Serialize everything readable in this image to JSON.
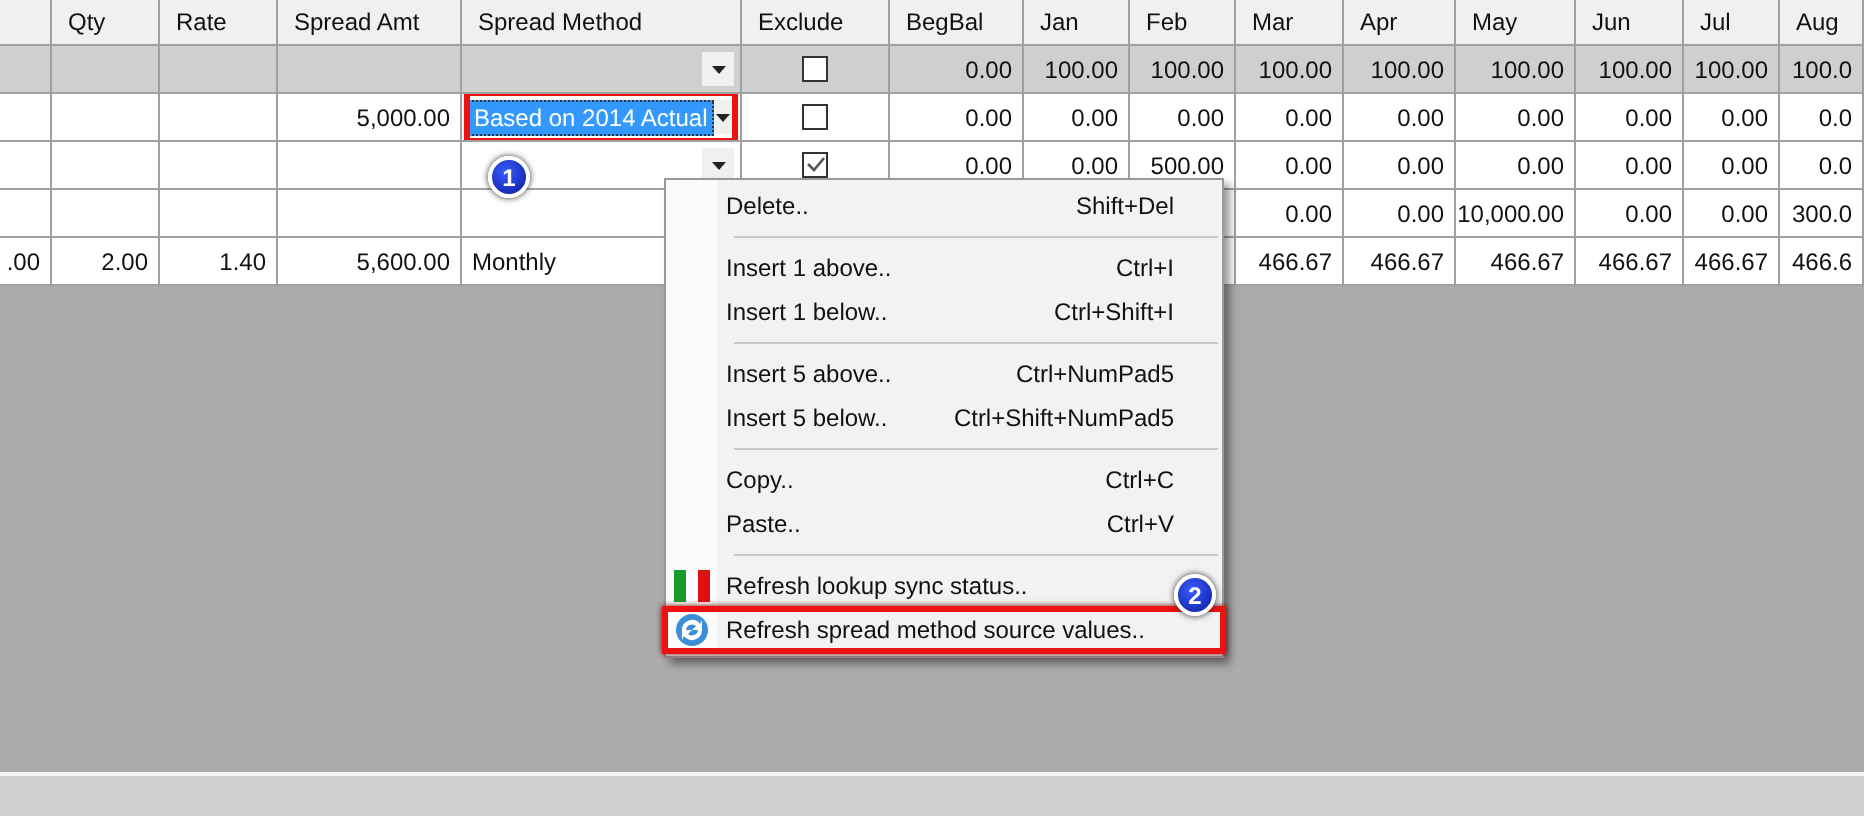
{
  "columns": [
    null,
    "Qty",
    "Rate",
    "Spread Amt",
    "Spread Method",
    "Exclude",
    "BegBal",
    "Jan",
    "Feb",
    "Mar",
    "Apr",
    "May",
    "Jun",
    "Jul",
    "Aug"
  ],
  "rows": [
    {
      "kind": "filter",
      "cells": [
        null,
        null,
        null,
        null,
        {
          "kind": "dropdown",
          "highlighted": false
        },
        {
          "kind": "checkbox",
          "checked": false
        },
        "0.00",
        "100.00",
        "100.00",
        "100.00",
        "100.00",
        "100.00",
        "100.00",
        "100.00",
        "100.0"
      ]
    },
    {
      "kind": "data",
      "cells": [
        null,
        null,
        null,
        "5,000.00",
        {
          "kind": "dropdown",
          "value": "Based on 2014 Actual",
          "highlighted": true
        },
        {
          "kind": "checkbox",
          "checked": false
        },
        "0.00",
        "0.00",
        "0.00",
        "0.00",
        "0.00",
        "0.00",
        "0.00",
        "0.00",
        "0.0"
      ]
    },
    {
      "kind": "data",
      "cells": [
        null,
        null,
        null,
        null,
        {
          "kind": "dropdown",
          "highlighted": false
        },
        {
          "kind": "checkbox",
          "checked": true
        },
        "0.00",
        "0.00",
        "500.00",
        "0.00",
        "0.00",
        "0.00",
        "0.00",
        "0.00",
        "0.0"
      ]
    },
    {
      "kind": "data",
      "cells": [
        null,
        null,
        null,
        null,
        null,
        null,
        null,
        null,
        null,
        "0.00",
        "0.00",
        "10,000.00",
        "0.00",
        "0.00",
        "300.0"
      ]
    },
    {
      "kind": "data",
      "cells": [
        ".00",
        "2.00",
        "1.40",
        "5,600.00",
        "Monthly",
        null,
        null,
        null,
        null,
        "466.67",
        "466.67",
        "466.67",
        "466.67",
        "466.67",
        "466.6"
      ]
    }
  ],
  "context_menu": {
    "groups": [
      [
        {
          "label": "Delete..",
          "shortcut": "Shift+Del",
          "highlighted": false
        }
      ],
      [
        {
          "label": "Insert 1 above..",
          "shortcut": "Ctrl+I",
          "highlighted": false
        },
        {
          "label": "Insert 1 below..",
          "shortcut": "Ctrl+Shift+I",
          "highlighted": false
        }
      ],
      [
        {
          "label": "Insert 5 above..",
          "shortcut": "Ctrl+NumPad5",
          "highlighted": false
        },
        {
          "label": "Insert 5 below..",
          "shortcut": "Ctrl+Shift+NumPad5",
          "highlighted": false
        }
      ],
      [
        {
          "label": "Copy..",
          "shortcut": "Ctrl+C",
          "highlighted": false
        },
        {
          "label": "Paste..",
          "shortcut": "Ctrl+V",
          "highlighted": false
        }
      ],
      [
        {
          "label": "Refresh lookup sync status..",
          "highlighted": false
        },
        {
          "label": "Refresh spread method source values..",
          "highlighted": true
        }
      ]
    ]
  },
  "callouts": [
    "1",
    "2"
  ]
}
